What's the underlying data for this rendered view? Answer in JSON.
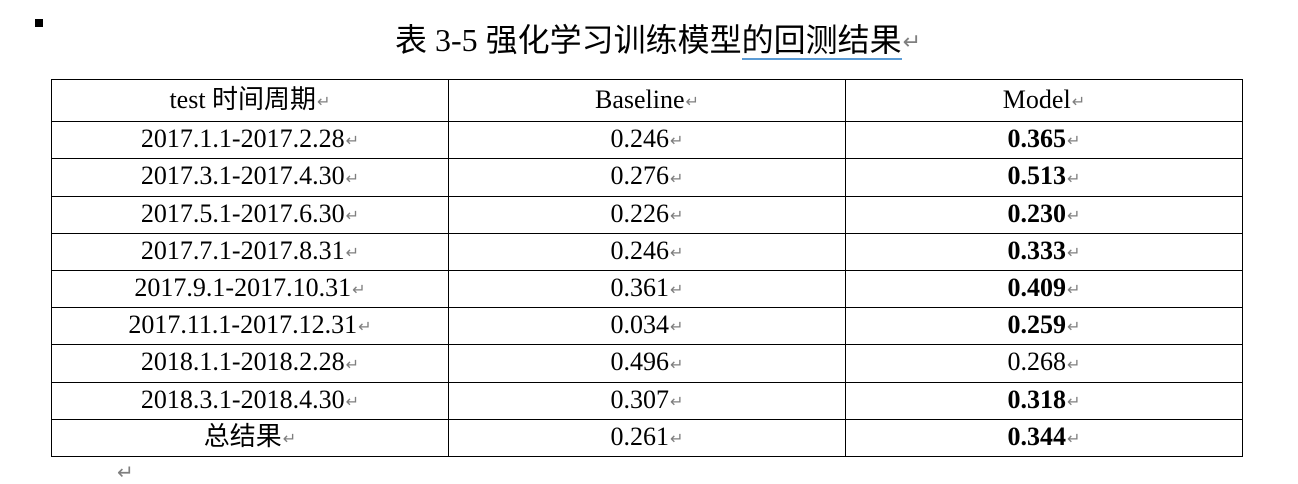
{
  "caption": {
    "prefix": "表 3-5  强化学习训练模型",
    "underlined": "的回测结果"
  },
  "table": {
    "headers": [
      "test 时间周期",
      "Baseline",
      "Model"
    ],
    "rows": [
      {
        "period": "2017.1.1-2017.2.28",
        "baseline": "0.246",
        "model": "0.365",
        "model_bold": true
      },
      {
        "period": "2017.3.1-2017.4.30",
        "baseline": "0.276",
        "model": "0.513",
        "model_bold": true
      },
      {
        "period": "2017.5.1-2017.6.30",
        "baseline": "0.226",
        "model": "0.230",
        "model_bold": true
      },
      {
        "period": "2017.7.1-2017.8.31",
        "baseline": "0.246",
        "model": "0.333",
        "model_bold": true
      },
      {
        "period": "2017.9.1-2017.10.31",
        "baseline": "0.361",
        "model": "0.409",
        "model_bold": true
      },
      {
        "period": "2017.11.1-2017.12.31",
        "baseline": "0.034",
        "model": "0.259",
        "model_bold": true
      },
      {
        "period": "2018.1.1-2018.2.28",
        "baseline": "0.496",
        "model": "0.268",
        "model_bold": false
      },
      {
        "period": "2018.3.1-2018.4.30",
        "baseline": "0.307",
        "model": "0.318",
        "model_bold": true
      },
      {
        "period": "总结果",
        "baseline": "0.261",
        "model": "0.344",
        "model_bold": true
      }
    ]
  },
  "marks": {
    "paragraph_mark": "↵",
    "paragraph_mark_color": "#7f7f7f",
    "underline_color": "#5b9bd5"
  }
}
